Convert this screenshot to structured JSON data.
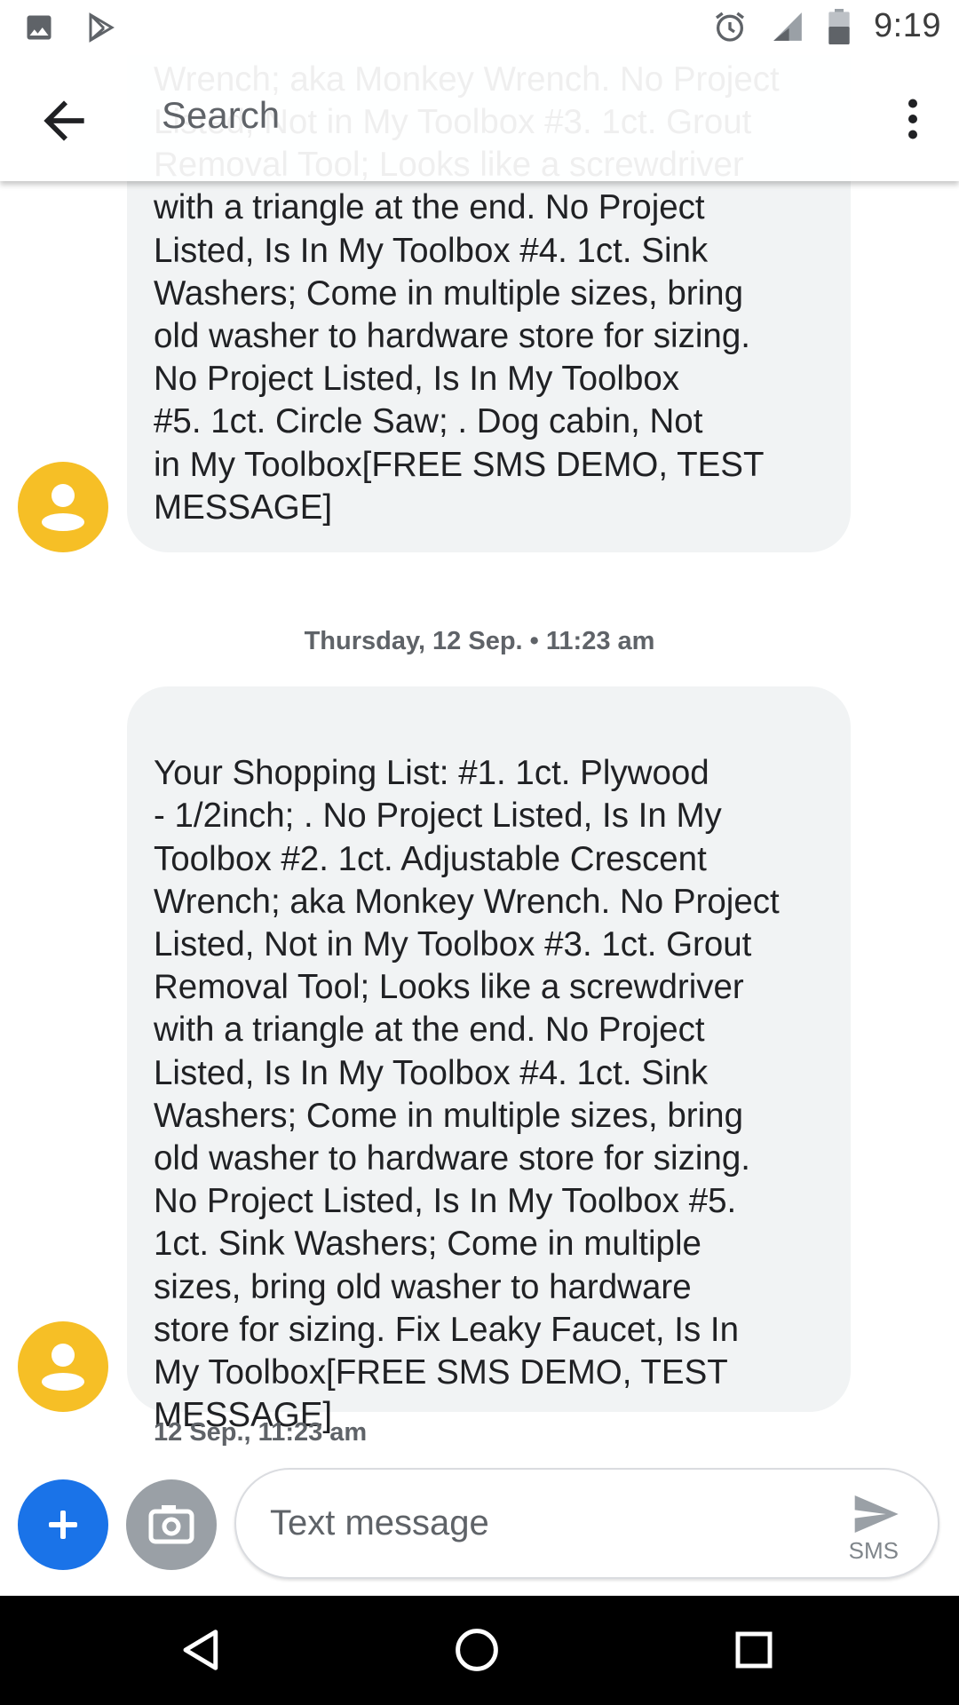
{
  "status_bar": {
    "time": "9:19",
    "left_icons": [
      "image-icon",
      "play-store-icon"
    ],
    "right_icons": [
      "alarm-icon",
      "signal-icon",
      "battery-icon"
    ]
  },
  "app_bar": {
    "search_placeholder": "Search"
  },
  "conversation": {
    "messages": [
      {
        "text": "Wrench; aka Monkey Wrench. No Project\nListed, Not in My Toolbox #3. 1ct.  Grout\nRemoval Tool; Looks like a screwdriver\nwith a triangle at the end. No Project\nListed, Is In My Toolbox #4. 1ct.  Sink\nWashers; Come in multiple sizes, bring\nold washer to hardware store for sizing.\nNo Project Listed, Is In My Toolbox\n#5. 1ct.  Circle Saw; . Dog cabin, Not\nin My Toolbox[FREE SMS DEMO, TEST\nMESSAGE]"
      },
      {
        "text": "Your Shopping List: #1. 1ct.  Plywood\n- 1/2inch; . No Project Listed, Is In My\nToolbox #2. 1ct.  Adjustable Crescent\nWrench; aka Monkey Wrench. No Project\nListed, Not in My Toolbox #3. 1ct.  Grout\nRemoval Tool; Looks like a screwdriver\nwith a triangle at the end. No Project\nListed, Is In My Toolbox #4. 1ct.  Sink\nWashers; Come in multiple sizes, bring\nold washer to hardware store for sizing.\nNo Project Listed, Is In My Toolbox #5.\n1ct.  Sink Washers; Come in multiple\nsizes, bring old washer to hardware\nstore for sizing. Fix Leaky Faucet, Is In\nMy Toolbox[FREE SMS DEMO, TEST\nMESSAGE]"
      }
    ],
    "date_separator": "Thursday, 12 Sep. • 11:23 am",
    "last_timestamp": "12 Sep., 11:23 am"
  },
  "compose": {
    "placeholder": "Text message",
    "send_type_label": "SMS"
  },
  "colors": {
    "avatar": "#f6bf26",
    "fab": "#1a73e8",
    "bubble": "#f1f3f4"
  }
}
